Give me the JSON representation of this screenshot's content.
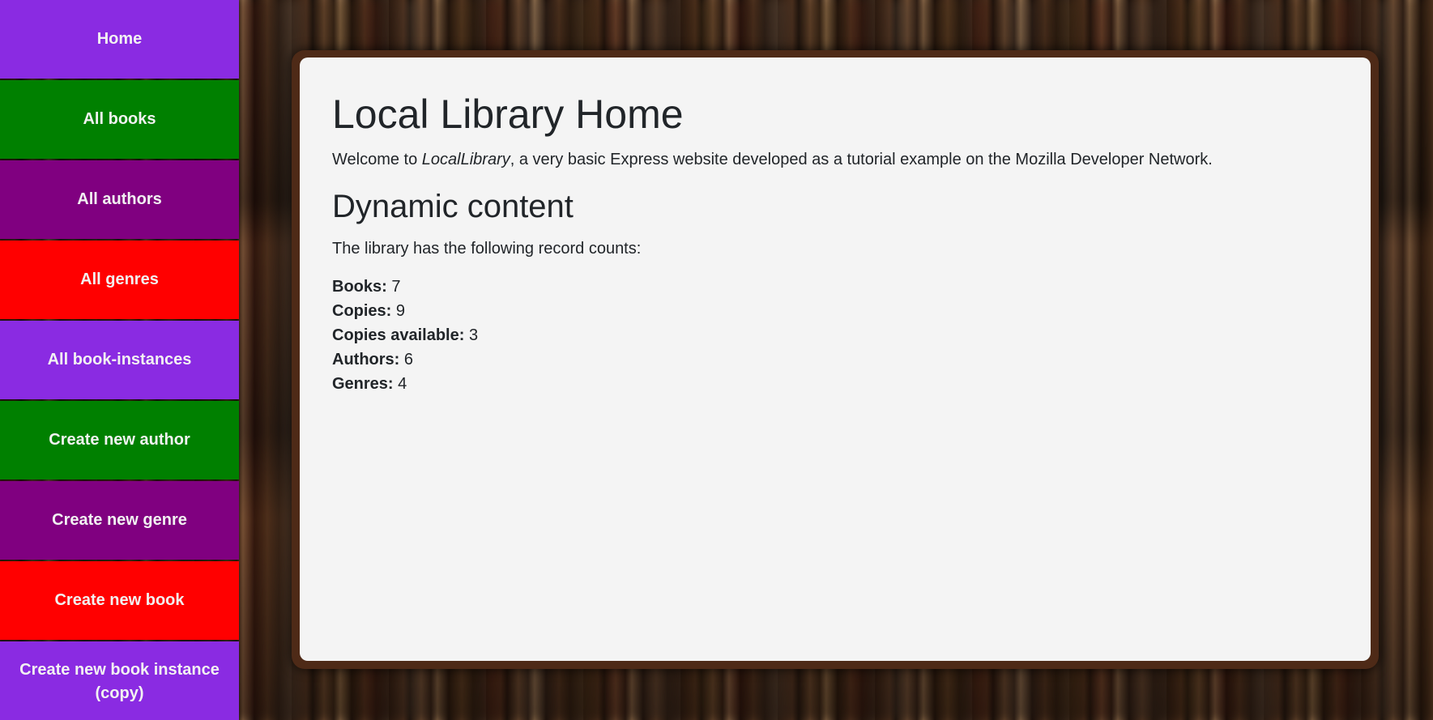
{
  "nav": {
    "items": [
      {
        "label": "Home",
        "color": "#8a2be2"
      },
      {
        "label": "All books",
        "color": "#008000"
      },
      {
        "label": "All authors",
        "color": "#800080"
      },
      {
        "label": "All genres",
        "color": "#ff0000"
      },
      {
        "label": "All book-instances",
        "color": "#8a2be2"
      },
      {
        "label": "Create new author",
        "color": "#008000"
      },
      {
        "label": "Create new genre",
        "color": "#800080"
      },
      {
        "label": "Create new book",
        "color": "#ff0000"
      },
      {
        "label": "Create new book instance (copy)",
        "color": "#8a2be2"
      }
    ]
  },
  "main": {
    "title": "Local Library Home",
    "intro": {
      "prefix": "Welcome to ",
      "site_name": "LocalLibrary",
      "suffix": ", a very basic Express website developed as a tutorial example on the Mozilla Developer Network."
    },
    "section_title": "Dynamic content",
    "counts_intro": "The library has the following record counts:",
    "counts": [
      {
        "label": "Books:",
        "value": "7"
      },
      {
        "label": "Copies:",
        "value": "9"
      },
      {
        "label": "Copies available:",
        "value": "3"
      },
      {
        "label": "Authors:",
        "value": "6"
      },
      {
        "label": "Genres:",
        "value": "4"
      }
    ]
  },
  "colors": {
    "frame": "#4e2a17",
    "panel": "#f4f4f4"
  }
}
